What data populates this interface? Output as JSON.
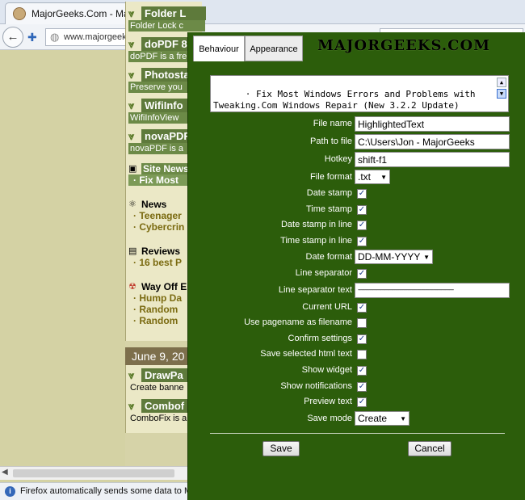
{
  "browser": {
    "tab_title": "MajorGeeks.Com - MajorG",
    "tab_close": "✕",
    "new_tab": "+",
    "back": "←",
    "url": "www.majorgeeks.com"
  },
  "page": {
    "entries": [
      {
        "title": "Folder L",
        "desc": "Folder Lock c"
      },
      {
        "title": "doPDF 8",
        "desc": "doPDF is a fre"
      },
      {
        "title": "Photosta",
        "desc": "Preserve you"
      },
      {
        "title": "WifiInfo",
        "desc": "WifiInfoView"
      },
      {
        "title": "novaPDF",
        "desc": "novaPDF is a"
      }
    ],
    "site_news": {
      "head": "Site News",
      "item": "· Fix Most"
    },
    "news": {
      "head": "News",
      "items": [
        "· Teenager",
        "· Cybercrin"
      ]
    },
    "reviews": {
      "head": "Reviews",
      "items": [
        "· 16 best P"
      ]
    },
    "wayoff": {
      "head": "Way Off E",
      "items": [
        "· Hump Da",
        "· Random",
        "· Random"
      ]
    },
    "date": "June 9, 20",
    "entries2": [
      {
        "title": "DrawPa",
        "desc": "Create banne"
      },
      {
        "title": "Combof",
        "desc": "ComboFix is a"
      }
    ],
    "notification": "Firefox automatically sends some data to Moz"
  },
  "dialog": {
    "tabs": [
      "Behaviour",
      "Appearance"
    ],
    "logo": "MAJORGEEKS.COM",
    "snippet": "  · Fix Most Windows Errors and Problems with Tweaking.Com Windows Repair (New 3.2.2 Update)",
    "fields": {
      "file_name": {
        "label": "File name",
        "value": "HighlightedText"
      },
      "path": {
        "label": "Path to file",
        "value": "C:\\Users\\Jon - MajorGeeks"
      },
      "hotkey": {
        "label": "Hotkey",
        "value": "shift-f1"
      },
      "file_format": {
        "label": "File format",
        "value": ".txt"
      },
      "date_format": {
        "label": "Date format",
        "value": "DD-MM-YYYY"
      },
      "line_sep_text": {
        "label": "Line separator text",
        "value": "-----------------------------------------------------------------------"
      },
      "save_mode": {
        "label": "Save mode",
        "value": "Create"
      }
    },
    "checks": {
      "date_stamp": {
        "label": "Date stamp",
        "checked": true
      },
      "time_stamp": {
        "label": "Time stamp",
        "checked": true
      },
      "date_stamp_inline": {
        "label": "Date stamp in line",
        "checked": true
      },
      "time_stamp_inline": {
        "label": "Time stamp in line",
        "checked": true
      },
      "line_separator": {
        "label": "Line separator",
        "checked": true
      },
      "current_url": {
        "label": "Current URL",
        "checked": true
      },
      "use_pagename": {
        "label": "Use pagename as filename",
        "checked": false
      },
      "confirm_settings": {
        "label": "Confirm settings",
        "checked": true
      },
      "save_selected_html": {
        "label": "Save selected html text",
        "checked": false
      },
      "show_widget": {
        "label": "Show widget",
        "checked": true
      },
      "show_notifications": {
        "label": "Show notifications",
        "checked": true
      },
      "preview_text": {
        "label": "Preview text",
        "checked": true
      }
    },
    "save_label": "Save",
    "cancel_label": "Cancel"
  },
  "colors": {
    "dialog_bg": "#2c5d0b",
    "page_bg": "#d6d3a8"
  }
}
